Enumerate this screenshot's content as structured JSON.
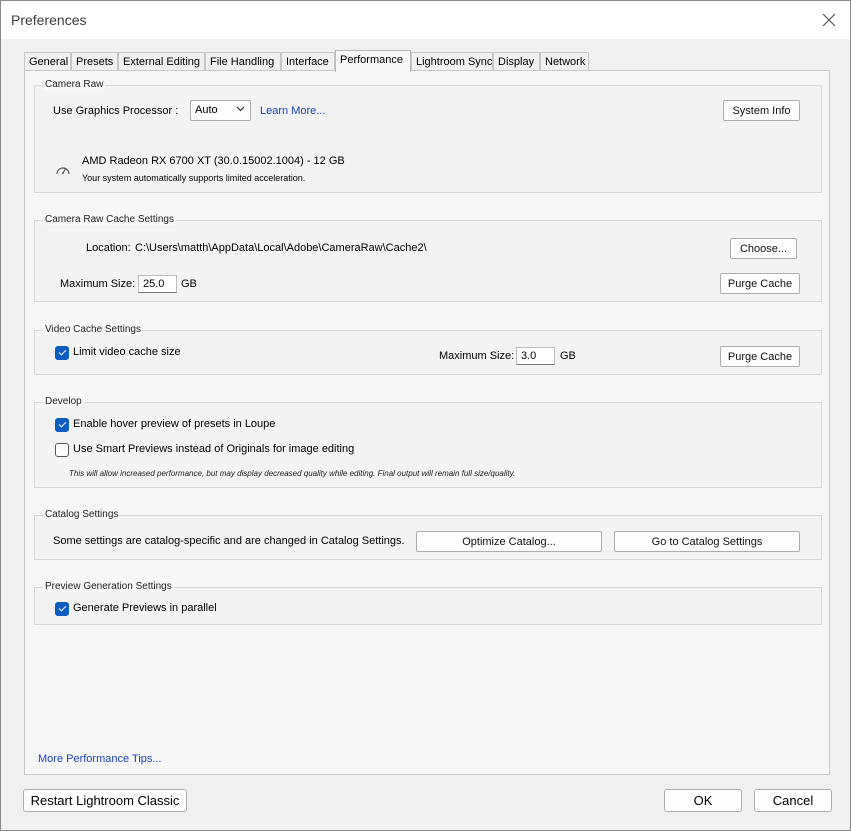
{
  "window": {
    "title": "Preferences"
  },
  "tabs": [
    {
      "label": "General"
    },
    {
      "label": "Presets"
    },
    {
      "label": "External Editing"
    },
    {
      "label": "File Handling"
    },
    {
      "label": "Interface"
    },
    {
      "label": "Performance",
      "active": true
    },
    {
      "label": "Lightroom Sync"
    },
    {
      "label": "Display"
    },
    {
      "label": "Network"
    }
  ],
  "camera_raw": {
    "group_label": "Camera Raw",
    "gpu_label": "Use Graphics Processor :",
    "gpu_value": "Auto",
    "learn_more": "Learn More...",
    "system_info": "System Info",
    "gpu_name": "AMD Radeon RX 6700 XT (30.0.15002.1004) - 12 GB",
    "gpu_status": "Your system automatically supports limited acceleration."
  },
  "camera_raw_cache": {
    "group_label": "Camera Raw Cache Settings",
    "location_label": "Location:",
    "location_path": "C:\\Users\\matth\\AppData\\Local\\Adobe\\CameraRaw\\Cache2\\",
    "choose_button": "Choose...",
    "max_size_label": "Maximum Size:",
    "max_size_value": "25.0",
    "unit": "GB",
    "purge_button": "Purge Cache"
  },
  "video_cache": {
    "group_label": "Video Cache Settings",
    "limit_label": "Limit video cache size",
    "limit_checked": true,
    "max_size_label": "Maximum Size:",
    "max_size_value": "3.0",
    "unit": "GB",
    "purge_button": "Purge Cache"
  },
  "develop": {
    "group_label": "Develop",
    "hover_preview_label": "Enable hover preview of presets in Loupe",
    "hover_preview_checked": true,
    "smart_previews_label": "Use Smart Previews instead of Originals for image editing",
    "smart_previews_checked": false,
    "smart_previews_note": "This will allow increased performance, but may display decreased quality while editing. Final output will remain full size/quality."
  },
  "catalog": {
    "group_label": "Catalog Settings",
    "description": "Some settings are catalog-specific and are changed in Catalog Settings.",
    "optimize_button": "Optimize Catalog...",
    "goto_button": "Go to Catalog Settings"
  },
  "preview_generation": {
    "group_label": "Preview Generation Settings",
    "parallel_label": "Generate Previews in parallel",
    "parallel_checked": true
  },
  "more_tips_link": "More Performance Tips...",
  "footer": {
    "restart_button": "Restart Lightroom Classic",
    "ok_button": "OK",
    "cancel_button": "Cancel"
  }
}
